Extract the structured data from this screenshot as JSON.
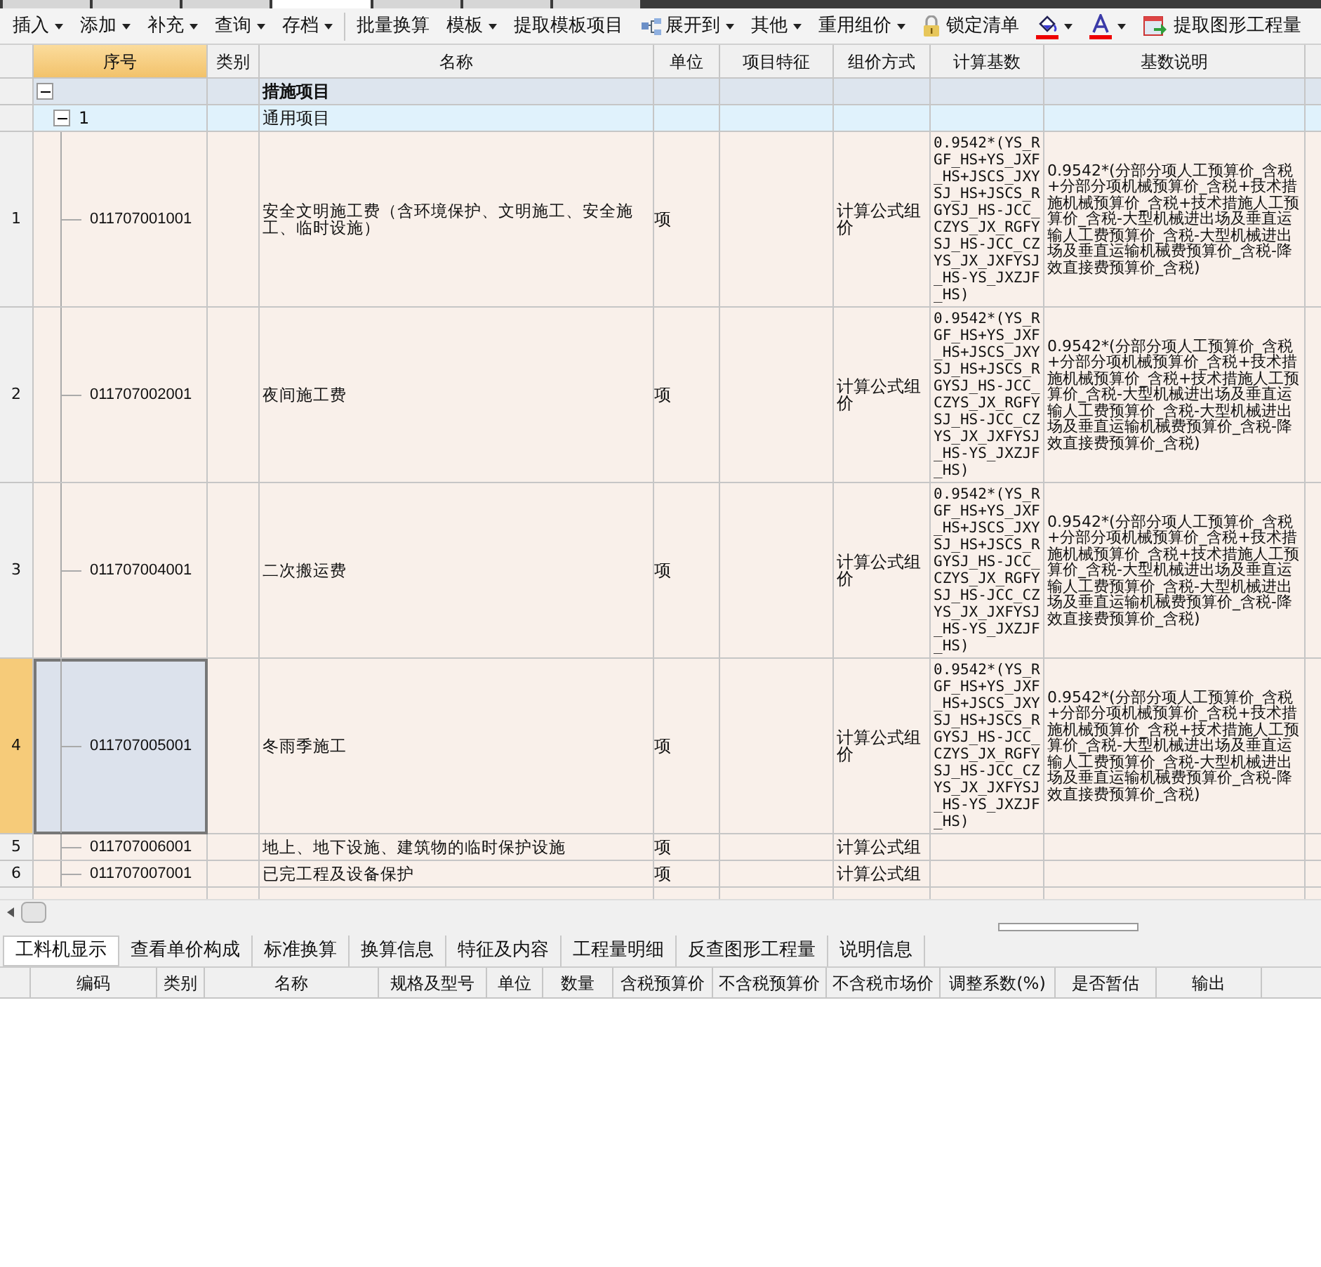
{
  "toolbar": {
    "groups": [
      [
        {
          "label": "插入",
          "dropdown": true,
          "kind": "text"
        },
        {
          "label": "添加",
          "dropdown": true,
          "kind": "text"
        },
        {
          "label": "补充",
          "dropdown": true,
          "kind": "text"
        },
        {
          "label": "查询",
          "dropdown": true,
          "kind": "text"
        },
        {
          "label": "存档",
          "dropdown": true,
          "kind": "text"
        }
      ],
      [
        {
          "label": "批量换算",
          "dropdown": false,
          "kind": "text"
        },
        {
          "label": "模板",
          "dropdown": true,
          "kind": "text"
        },
        {
          "label": "提取模板项目",
          "dropdown": false,
          "kind": "text"
        },
        {
          "label": "展开到",
          "dropdown": true,
          "kind": "tree"
        },
        {
          "label": "其他",
          "dropdown": true,
          "kind": "text"
        },
        {
          "label": "重用组价",
          "dropdown": true,
          "kind": "text"
        },
        {
          "label": "锁定清单",
          "dropdown": false,
          "kind": "lock"
        },
        {
          "dropdown": true,
          "kind": "fill"
        },
        {
          "dropdown": true,
          "kind": "font"
        },
        {
          "label": "提取图形工程量",
          "dropdown": false,
          "kind": "extract"
        }
      ]
    ]
  },
  "table": {
    "columns": [
      "序号",
      "类别",
      "名称",
      "单位",
      "项目特征",
      "组价方式",
      "计算基数",
      "基数说明"
    ],
    "rows": [
      {
        "kind": "group",
        "name": "措施项目",
        "expanded": true,
        "selected": false
      },
      {
        "kind": "subgroup",
        "code": "1",
        "name": "通用项目",
        "expanded": true,
        "selected": false
      },
      {
        "kind": "item",
        "num": "1",
        "code": "011707001001",
        "name": "安全文明施工费（含环境保护、文明施工、安全施工、临时设施）",
        "unit": "项",
        "method": "计算公式组价",
        "base": "0.9542*(YS_RGF_HS+YS_JXF_HS+JSCS_JXYSJ_HS+JSCS_RGYSJ_HS-JCC_CZYS_JX_RGFYSJ_HS-JCC_CZYS_JX_JXFYSJ_HS-YS_JXZJF_HS)",
        "base_desc": "0.9542*(分部分项人工预算价_含税+分部分项机械预算价_含税+技术措施机械预算价_含税+技术措施人工预算价_含税-大型机械进出场及垂直运输人工费预算价_含税-大型机械进出场及垂直运输机械费预算价_含税-降效直接费预算价_含税)",
        "selected": false
      },
      {
        "kind": "item",
        "num": "2",
        "code": "011707002001",
        "name": "夜间施工费",
        "unit": "项",
        "method": "计算公式组价",
        "base": "0.9542*(YS_RGF_HS+YS_JXF_HS+JSCS_JXYSJ_HS+JSCS_RGYSJ_HS-JCC_CZYS_JX_RGFYSJ_HS-JCC_CZYS_JX_JXFYSJ_HS-YS_JXZJF_HS)",
        "base_desc": "0.9542*(分部分项人工预算价_含税+分部分项机械预算价_含税+技术措施机械预算价_含税+技术措施人工预算价_含税-大型机械进出场及垂直运输人工费预算价_含税-大型机械进出场及垂直运输机械费预算价_含税-降效直接费预算价_含税)",
        "selected": false
      },
      {
        "kind": "item",
        "num": "3",
        "code": "011707004001",
        "name": "二次搬运费",
        "unit": "项",
        "method": "计算公式组价",
        "base": "0.9542*(YS_RGF_HS+YS_JXF_HS+JSCS_JXYSJ_HS+JSCS_RGYSJ_HS-JCC_CZYS_JX_RGFYSJ_HS-JCC_CZYS_JX_JXFYSJ_HS-YS_JXZJF_HS)",
        "base_desc": "0.9542*(分部分项人工预算价_含税+分部分项机械预算价_含税+技术措施机械预算价_含税+技术措施人工预算价_含税-大型机械进出场及垂直运输人工费预算价_含税-大型机械进出场及垂直运输机械费预算价_含税-降效直接费预算价_含税)",
        "selected": false
      },
      {
        "kind": "item",
        "num": "4",
        "code": "011707005001",
        "name": "冬雨季施工",
        "unit": "项",
        "method": "计算公式组价",
        "base": "0.9542*(YS_RGF_HS+YS_JXF_HS+JSCS_JXYSJ_HS+JSCS_RGYSJ_HS-JCC_CZYS_JX_RGFYSJ_HS-JCC_CZYS_JX_JXFYSJ_HS-YS_JXZJF_HS)",
        "base_desc": "0.9542*(分部分项人工预算价_含税+分部分项机械预算价_含税+技术措施机械预算价_含税+技术措施人工预算价_含税-大型机械进出场及垂直运输人工费预算价_含税-大型机械进出场及垂直运输机械费预算价_含税-降效直接费预算价_含税)",
        "selected": true
      },
      {
        "kind": "item",
        "num": "5",
        "code": "011707006001",
        "name": "地上、地下设施、建筑物的临时保护设施",
        "unit": "项",
        "method": "计算公式组",
        "selected": false
      },
      {
        "kind": "item",
        "num": "6",
        "code": "011707007001",
        "name": "已完工程及设备保护",
        "unit": "项",
        "method": "计算公式组",
        "selected": false
      }
    ]
  },
  "detail_tabs": [
    {
      "label": "工料机显示",
      "selected": true
    },
    {
      "label": "查看单价构成",
      "selected": false
    },
    {
      "label": "标准换算",
      "selected": false
    },
    {
      "label": "换算信息",
      "selected": false
    },
    {
      "label": "特征及内容",
      "selected": false
    },
    {
      "label": "工程量明细",
      "selected": false
    },
    {
      "label": "反查图形工程量",
      "selected": false
    },
    {
      "label": "说明信息",
      "selected": false
    }
  ],
  "detail_table": {
    "columns": [
      "编码",
      "类别",
      "名称",
      "规格及型号",
      "单位",
      "数量",
      "含税预算价",
      "不含税预算价",
      "不含税市场价",
      "调整系数(%)",
      "是否暂估",
      "输出"
    ]
  }
}
